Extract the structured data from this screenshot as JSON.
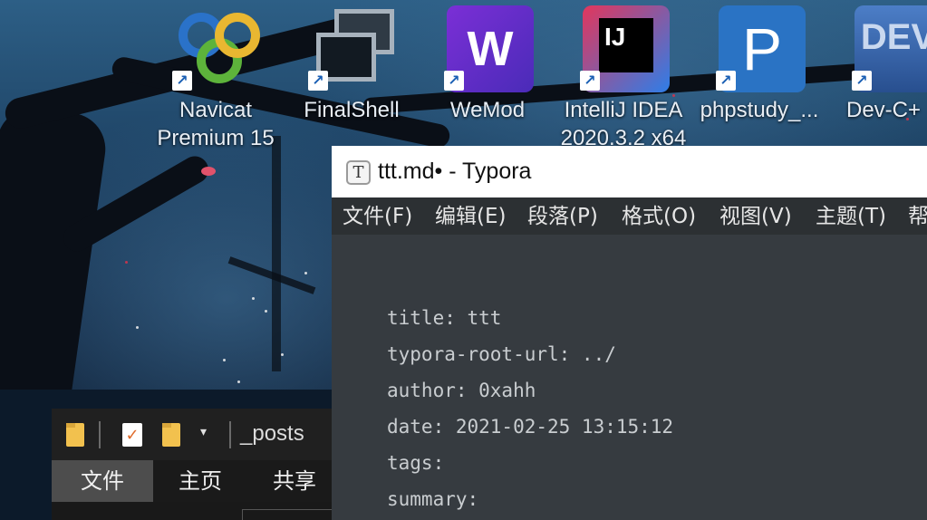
{
  "desktop": {
    "icons": [
      {
        "label_line1": "Navicat",
        "label_line2": "Premium 15",
        "icon": "navicat-icon"
      },
      {
        "label_line1": "FinalShell",
        "label_line2": "",
        "icon": "finalshell-icon"
      },
      {
        "label_line1": "WeMod",
        "label_line2": "",
        "icon": "wemod-icon",
        "glyph": "W"
      },
      {
        "label_line1": "IntelliJ IDEA",
        "label_line2": "2020.3.2 x64",
        "icon": "intellij-idea-icon",
        "glyph": "IJ"
      },
      {
        "label_line1": "phpstudy_...",
        "label_line2": "",
        "icon": "phpstudy-icon",
        "glyph": "P"
      },
      {
        "label_line1": "Dev-C+",
        "label_line2": "",
        "icon": "dev-cpp-icon",
        "glyph": "DEV"
      }
    ],
    "shortcut_arrow": "↗"
  },
  "explorer": {
    "path": "_posts",
    "caret": "▾",
    "check_glyph": "✓",
    "tabs": [
      "文件",
      "主页",
      "共享"
    ],
    "active_tab": "文件"
  },
  "typora": {
    "app_icon_glyph": "T",
    "title": "ttt.md• - Typora",
    "menu": [
      "文件(F)",
      "编辑(E)",
      "段落(P)",
      "格式(O)",
      "视图(V)",
      "主题(T)",
      "帮"
    ],
    "front_matter": [
      "title: ttt",
      "typora-root-url: ../",
      "author: 0xahh",
      "date: 2021-02-25 13:15:12",
      "tags:",
      "summary:"
    ]
  },
  "colors": {
    "typora_editor_bg": "#363b40",
    "typora_menubar_bg": "#2c3033",
    "explorer_bg": "#202020",
    "folder_yellow": "#f2c14e"
  }
}
